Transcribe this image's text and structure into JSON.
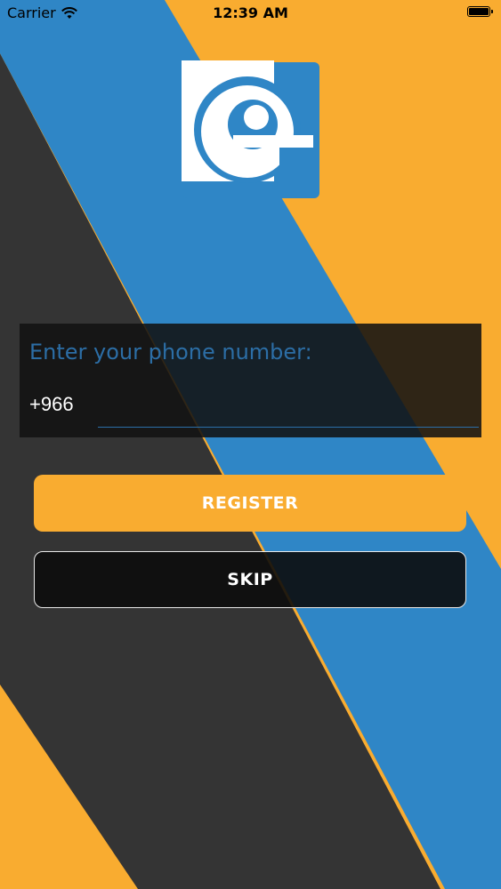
{
  "status_bar": {
    "carrier": "Carrier",
    "time": "12:39 AM"
  },
  "colors": {
    "orange": "#f9ac30",
    "blue": "#2f86c6",
    "dark": "#343434"
  },
  "phone_form": {
    "label": "Enter your phone number:",
    "country_code": "+966",
    "phone_value": ""
  },
  "buttons": {
    "register": "REGISTER",
    "skip": "SKIP"
  }
}
